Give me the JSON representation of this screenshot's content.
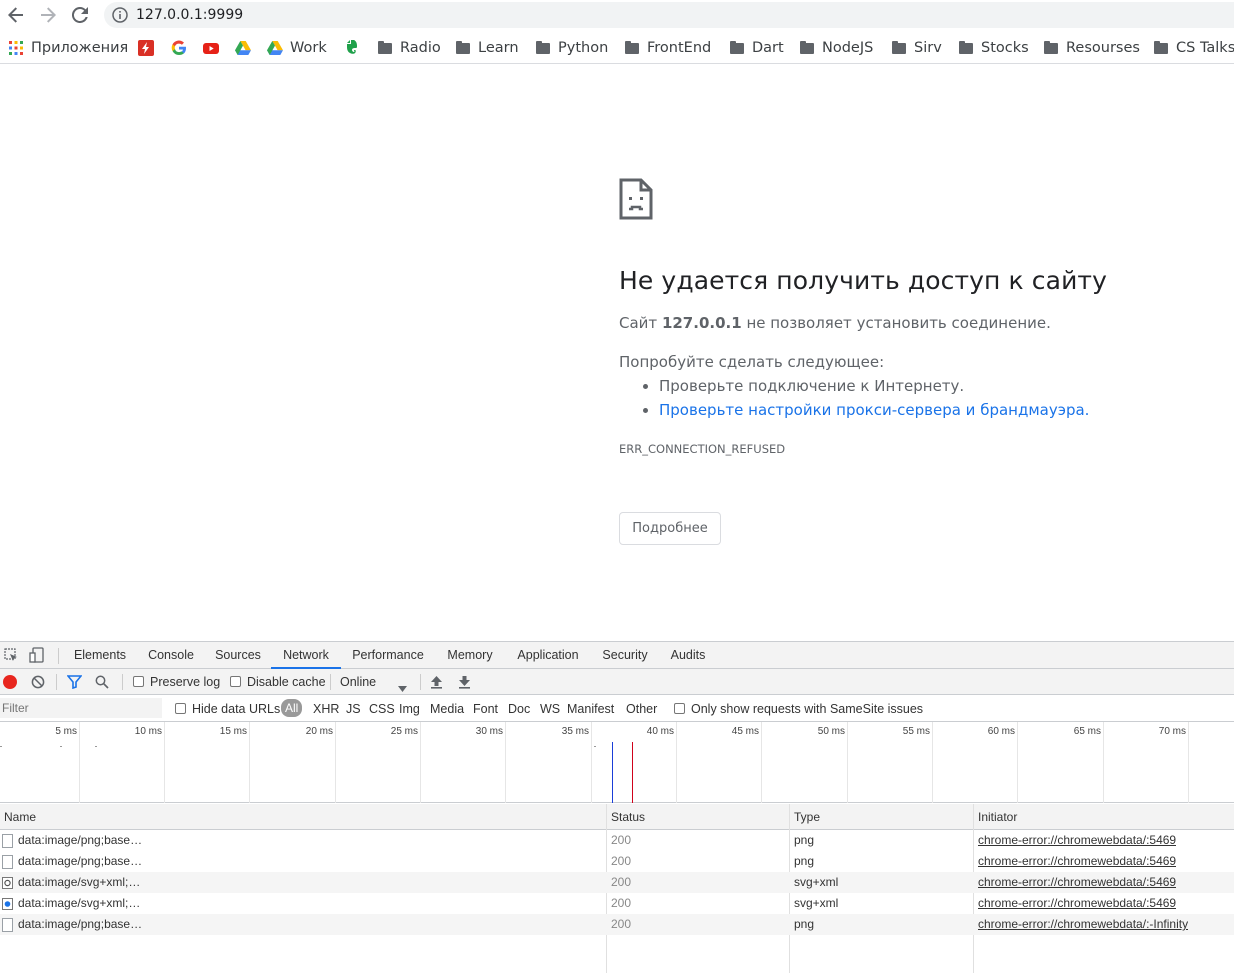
{
  "browser": {
    "url": "127.0.0.1:9999",
    "bookmarks": [
      {
        "label": "Приложения",
        "icon": "apps-grid-icon"
      },
      {
        "label": "",
        "icon": "flash-icon"
      },
      {
        "label": "",
        "icon": "google-icon"
      },
      {
        "label": "",
        "icon": "youtube-icon"
      },
      {
        "label": "",
        "icon": "drive-icon"
      },
      {
        "label": "Work",
        "icon": "drive-icon"
      },
      {
        "label": "",
        "icon": "evernote-icon"
      },
      {
        "label": "Radio",
        "icon": "folder-icon"
      },
      {
        "label": "Learn",
        "icon": "folder-icon"
      },
      {
        "label": "Python",
        "icon": "folder-icon"
      },
      {
        "label": "FrontEnd",
        "icon": "folder-icon"
      },
      {
        "label": "Dart",
        "icon": "folder-icon"
      },
      {
        "label": "NodeJS",
        "icon": "folder-icon"
      },
      {
        "label": "Sirv",
        "icon": "folder-icon"
      },
      {
        "label": "Stocks",
        "icon": "folder-icon"
      },
      {
        "label": "Resourses",
        "icon": "folder-icon"
      },
      {
        "label": "CS Talks",
        "icon": "folder-icon"
      }
    ]
  },
  "error_page": {
    "title": "Не удается получить доступ к сайту",
    "line1_prefix": "Сайт",
    "line1_host": "127.0.0.1",
    "line1_suffix": "не позволяет установить соединение.",
    "try_heading": "Попробуйте сделать следующее:",
    "suggestions": [
      "Проверьте подключение к Интернету.",
      "Проверьте настройки прокси-сервера и брандмауэра."
    ],
    "error_code": "ERR_CONNECTION_REFUSED",
    "details_button": "Подробнее"
  },
  "devtools": {
    "tabs": [
      "Elements",
      "Console",
      "Sources",
      "Network",
      "Performance",
      "Memory",
      "Application",
      "Security",
      "Audits"
    ],
    "active_tab": "Network",
    "toolbar": {
      "preserve_log": "Preserve log",
      "disable_cache": "Disable cache",
      "throttle": "Online"
    },
    "filter_bar": {
      "filter_placeholder": "Filter",
      "hide_data_urls": "Hide data URLs",
      "types": [
        "All",
        "XHR",
        "JS",
        "CSS",
        "Img",
        "Media",
        "Font",
        "Doc",
        "WS",
        "Manifest",
        "Other"
      ],
      "samesite": "Only show requests with SameSite issues"
    },
    "timeline_ticks": [
      "5 ms",
      "10 ms",
      "15 ms",
      "20 ms",
      "25 ms",
      "30 ms",
      "35 ms",
      "40 ms",
      "45 ms",
      "50 ms",
      "55 ms",
      "60 ms",
      "65 ms",
      "70 ms"
    ],
    "columns": [
      "Name",
      "Status",
      "Type",
      "Initiator"
    ],
    "rows": [
      {
        "name": "data:image/png;base…",
        "status": "200",
        "type": "png",
        "initiator": "chrome-error://chromewebdata/:5469"
      },
      {
        "name": "data:image/png;base…",
        "status": "200",
        "type": "png",
        "initiator": "chrome-error://chromewebdata/:5469"
      },
      {
        "name": "data:image/svg+xml;…",
        "status": "200",
        "type": "svg+xml",
        "initiator": "chrome-error://chromewebdata/:5469"
      },
      {
        "name": "data:image/svg+xml;…",
        "status": "200",
        "type": "svg+xml",
        "initiator": "chrome-error://chromewebdata/:5469"
      },
      {
        "name": "data:image/png;base…",
        "status": "200",
        "type": "png",
        "initiator": "chrome-error://chromewebdata/:-Infinity"
      }
    ],
    "colors": {
      "record": "#e8261e",
      "accent": "#1a73e8",
      "dom_line": "#1a3ed8",
      "load_line": "#d0021b"
    }
  }
}
